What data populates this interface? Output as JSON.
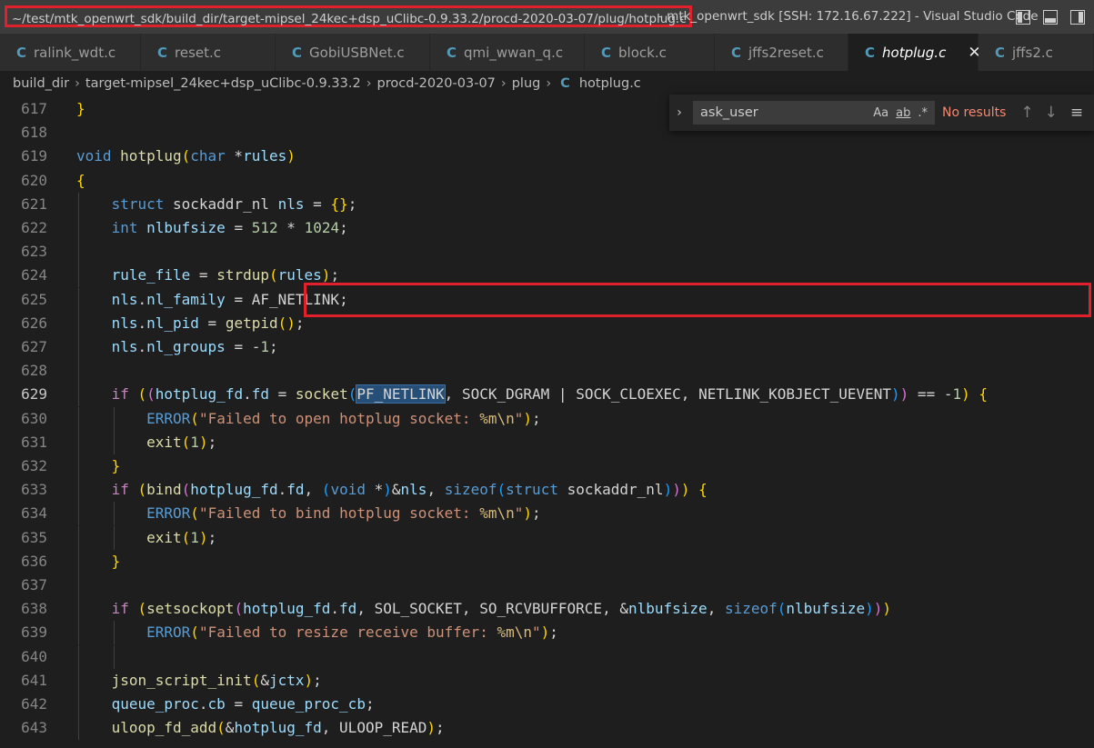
{
  "titlebar": {
    "path": "~/test/mtk_openwrt_sdk/build_dir/target-mipsel_24kec+dsp_uClibc-0.9.33.2/procd-2020-03-07/plug/hotplug.c",
    "rest": " - mtk_openwrt_sdk [SSH: 172.16.67.222] - Visual Studio Code"
  },
  "tabs": [
    {
      "label": "ralink_wdt.c",
      "icon": "C"
    },
    {
      "label": "reset.c",
      "icon": "C"
    },
    {
      "label": "GobiUSBNet.c",
      "icon": "C"
    },
    {
      "label": "qmi_wwan_q.c",
      "icon": "C"
    },
    {
      "label": "block.c",
      "icon": "C"
    },
    {
      "label": "jffs2reset.c",
      "icon": "C"
    },
    {
      "label": "hotplug.c",
      "icon": "C",
      "close": "✕"
    },
    {
      "label": "jffs2.c",
      "icon": "C"
    }
  ],
  "breadcrumb": {
    "items": [
      "build_dir",
      "target-mipsel_24kec+dsp_uClibc-0.9.33.2",
      "procd-2020-03-07",
      "plug"
    ],
    "file": "hotplug.c",
    "file_icon": "C"
  },
  "find": {
    "value": "ask_user",
    "match_case": "Aa",
    "whole_word": "ab",
    "regex": ".*",
    "status": "No results"
  },
  "editor": {
    "current_line": 629,
    "lines": [
      {
        "n": 617,
        "t": "}"
      },
      {
        "n": 618,
        "t": ""
      },
      {
        "n": 619,
        "t": "void hotplug(char *rules)"
      },
      {
        "n": 620,
        "t": "{"
      },
      {
        "n": 621,
        "t": "    struct sockaddr_nl nls = {};"
      },
      {
        "n": 622,
        "t": "    int nlbufsize = 512 * 1024;"
      },
      {
        "n": 623,
        "t": ""
      },
      {
        "n": 624,
        "t": "    rule_file = strdup(rules);"
      },
      {
        "n": 625,
        "t": "    nls.nl_family = AF_NETLINK;"
      },
      {
        "n": 626,
        "t": "    nls.nl_pid = getpid();"
      },
      {
        "n": 627,
        "t": "    nls.nl_groups = -1;"
      },
      {
        "n": 628,
        "t": ""
      },
      {
        "n": 629,
        "t": "    if ((hotplug_fd.fd = socket(PF_NETLINK, SOCK_DGRAM | SOCK_CLOEXEC, NETLINK_KOBJECT_UEVENT)) == -1) {"
      },
      {
        "n": 630,
        "t": "        ERROR(\"Failed to open hotplug socket: %m\\n\");"
      },
      {
        "n": 631,
        "t": "        exit(1);"
      },
      {
        "n": 632,
        "t": "    }"
      },
      {
        "n": 633,
        "t": "    if (bind(hotplug_fd.fd, (void *)&nls, sizeof(struct sockaddr_nl))) {"
      },
      {
        "n": 634,
        "t": "        ERROR(\"Failed to bind hotplug socket: %m\\n\");"
      },
      {
        "n": 635,
        "t": "        exit(1);"
      },
      {
        "n": 636,
        "t": "    }"
      },
      {
        "n": 637,
        "t": ""
      },
      {
        "n": 638,
        "t": "    if (setsockopt(hotplug_fd.fd, SOL_SOCKET, SO_RCVBUFFORCE, &nlbufsize, sizeof(nlbufsize)))"
      },
      {
        "n": 639,
        "t": "        ERROR(\"Failed to resize receive buffer: %m\\n\");"
      },
      {
        "n": 640,
        "t": ""
      },
      {
        "n": 641,
        "t": "    json_script_init(&jctx);"
      },
      {
        "n": 642,
        "t": "    queue_proc.cb = queue_proc_cb;"
      },
      {
        "n": 643,
        "t": "    uloop_fd_add(&hotplug_fd, ULOOP_READ);"
      }
    ]
  },
  "highlight": {
    "selected_word": "PF_NETLINK"
  }
}
